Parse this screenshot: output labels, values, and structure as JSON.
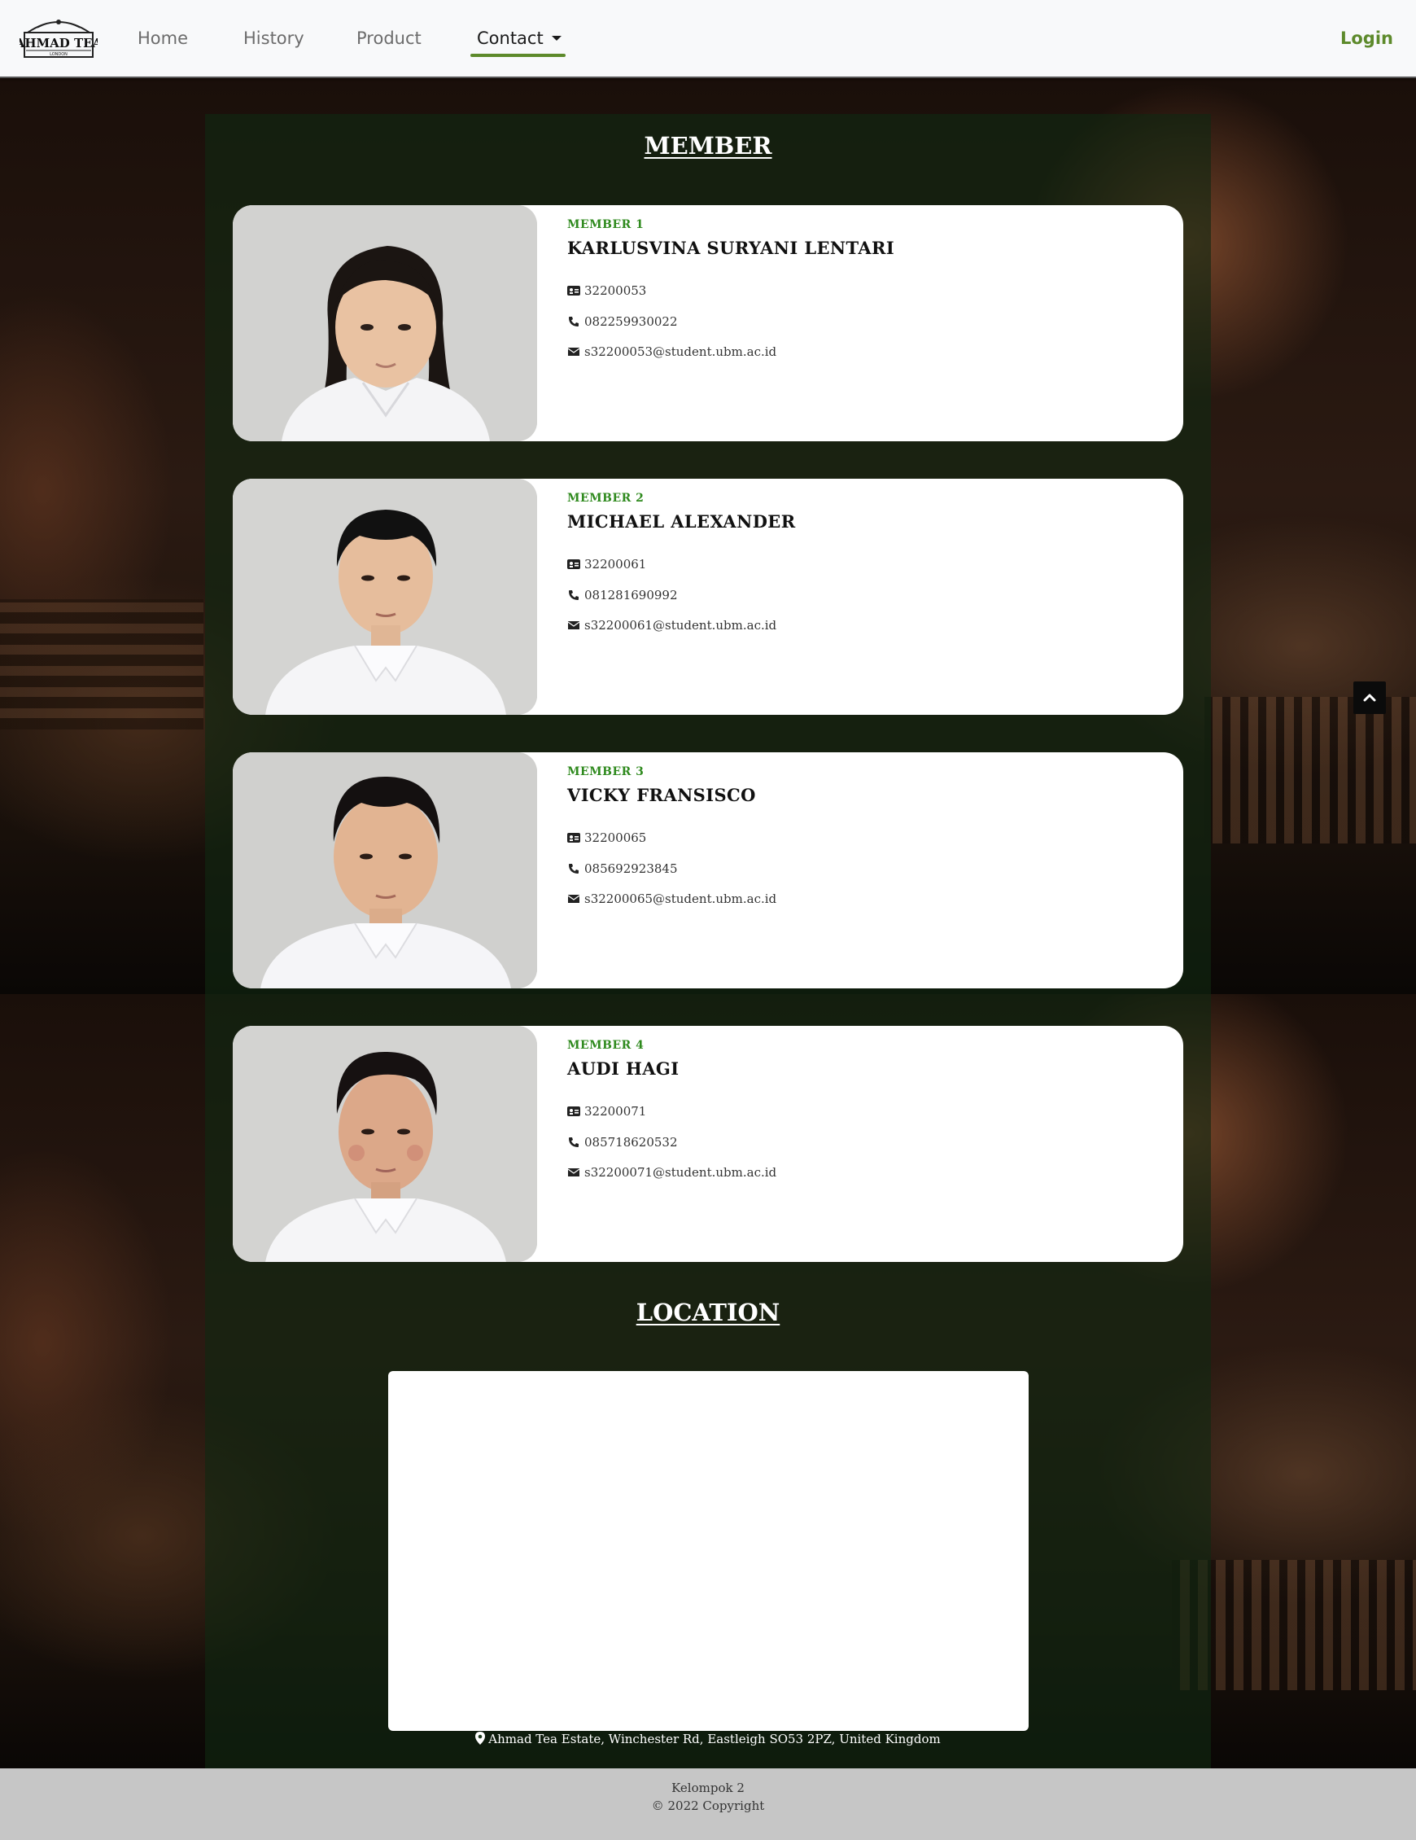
{
  "navbar": {
    "logo_text": "AHMAD TEA",
    "logo_subtext": "LONDON",
    "items": [
      {
        "label": "Home"
      },
      {
        "label": "History"
      },
      {
        "label": "Product"
      },
      {
        "label": "Contact"
      }
    ],
    "login_label": "Login",
    "active_item": "Contact",
    "accent_color": "#5d8a2b"
  },
  "member_section": {
    "title": "MEMBER",
    "members": [
      {
        "label": "MEMBER 1",
        "name": "KARLUSVINA SURYANI LENTARI",
        "id": "32200053",
        "phone": "082259930022",
        "email": "s32200053@student.ubm.ac.id"
      },
      {
        "label": "MEMBER 2",
        "name": "MICHAEL ALEXANDER",
        "id": "32200061",
        "phone": "081281690992",
        "email": "s32200061@student.ubm.ac.id"
      },
      {
        "label": "MEMBER 3",
        "name": "VICKY FRANSISCO",
        "id": "32200065",
        "phone": "085692923845",
        "email": "s32200065@student.ubm.ac.id"
      },
      {
        "label": "MEMBER 4",
        "name": "AUDI HAGI",
        "id": "32200071",
        "phone": "085718620532",
        "email": "s32200071@student.ubm.ac.id"
      }
    ],
    "label_color": "#2f8a1e"
  },
  "location_section": {
    "title": "LOCATION",
    "address": "Ahmad Tea Estate, Winchester Rd, Eastleigh SO53 2PZ, United Kingdom"
  },
  "footer": {
    "line1": "Kelompok 2",
    "line2": "© 2022 Copyright"
  },
  "icons": {
    "id_card": "id-card-icon",
    "phone": "phone-icon",
    "email": "envelope-icon",
    "location": "map-marker-icon",
    "scroll_top": "chevron-up-icon"
  }
}
